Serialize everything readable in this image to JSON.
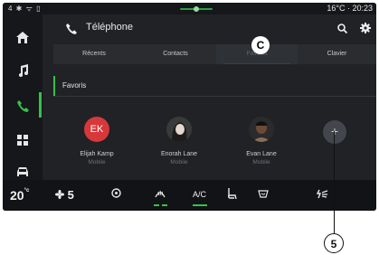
{
  "status": {
    "left_icons": "4 ✱ ᯤ ▯",
    "temperature": "16°C",
    "separator": "·",
    "time": "20:23"
  },
  "header": {
    "title": "Téléphone"
  },
  "tabs": [
    {
      "label": "Récents"
    },
    {
      "label": "Contacts"
    },
    {
      "label": "Favoris",
      "active": true
    },
    {
      "label": "Clavier"
    }
  ],
  "section": {
    "title": "Favoris"
  },
  "favorites": [
    {
      "initials": "EK",
      "name": "Elijah Kamp",
      "type": "Mobile"
    },
    {
      "name": "Enorah Lane",
      "type": "Mobile"
    },
    {
      "name": "Evan Lane",
      "type": "Mobile"
    }
  ],
  "add_button": {
    "symbol": "+"
  },
  "climate": {
    "left_temp": "20",
    "left_temp_unit": "°c",
    "fan_level": "5",
    "ac_label": "A/C"
  },
  "callouts": {
    "c": "C",
    "five": "5"
  },
  "colors": {
    "accent": "#36c24a",
    "background": "#1b1d21",
    "avatar_ek": "#d7383a"
  }
}
